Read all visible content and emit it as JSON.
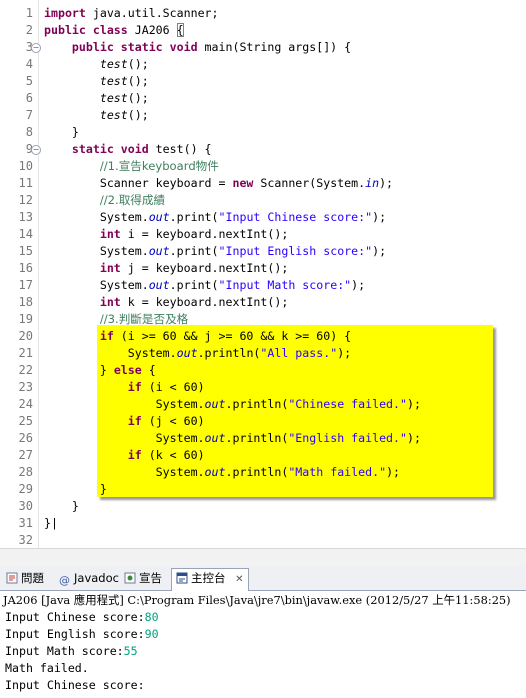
{
  "editor": {
    "lines": [
      {
        "n": "1",
        "html": "<span class=\"kw\">import</span> java.util.Scanner;"
      },
      {
        "n": "2",
        "html": "<span class=\"kw\">public class</span> JA206 <span class=\"bracket\">{</span>"
      },
      {
        "n": "3",
        "fold": "−",
        "html": "    <span class=\"kw\">public static void</span> main(String args[]) {"
      },
      {
        "n": "4",
        "html": "        <span class=\"it\">test</span>();"
      },
      {
        "n": "5",
        "html": "        <span class=\"it\">test</span>();"
      },
      {
        "n": "6",
        "html": "        <span class=\"it\">test</span>();"
      },
      {
        "n": "7",
        "html": "        <span class=\"it\">test</span>();"
      },
      {
        "n": "8",
        "html": "    }"
      },
      {
        "n": "9",
        "fold": "−",
        "html": "    <span class=\"kw\">static void</span> test() {"
      },
      {
        "n": "10",
        "html": "        <span class=\"cm\">//1.宣告keyboard物件</span>"
      },
      {
        "n": "11",
        "html": "        Scanner keyboard = <span class=\"kw\">new</span> Scanner(System.<span class=\"fld\">in</span>);"
      },
      {
        "n": "12",
        "html": "        <span class=\"cm\">//2.取得成績</span>"
      },
      {
        "n": "13",
        "html": "        System.<span class=\"fld\">out</span>.print(<span class=\"str\">\"Input Chinese score:\"</span>);"
      },
      {
        "n": "14",
        "html": "        <span class=\"kw\">int</span> i = keyboard.nextInt();"
      },
      {
        "n": "15",
        "html": "        System.<span class=\"fld\">out</span>.print(<span class=\"str\">\"Input English score:\"</span>);"
      },
      {
        "n": "16",
        "html": "        <span class=\"kw\">int</span> j = keyboard.nextInt();"
      },
      {
        "n": "17",
        "html": "        System.<span class=\"fld\">out</span>.print(<span class=\"str\">\"Input Math score:\"</span>);"
      },
      {
        "n": "18",
        "html": "        <span class=\"kw\">int</span> k = keyboard.nextInt();"
      },
      {
        "n": "19",
        "html": "        <span class=\"cm\">//3.判斷是否及格</span>"
      },
      {
        "n": "20",
        "html": "        <span class=\"kw\">if</span> (i >= 60 && j >= 60 && k >= 60) {"
      },
      {
        "n": "21",
        "html": "            System.<span class=\"fld\">out</span>.println(<span class=\"str\">\"All pass.\"</span>);"
      },
      {
        "n": "22",
        "html": "        } <span class=\"kw\">else</span> {"
      },
      {
        "n": "23",
        "html": "            <span class=\"kw\">if</span> (i < 60)"
      },
      {
        "n": "24",
        "html": "                System.<span class=\"fld\">out</span>.println(<span class=\"str\">\"Chinese failed.\"</span>);"
      },
      {
        "n": "25",
        "html": "            <span class=\"kw\">if</span> (j < 60)"
      },
      {
        "n": "26",
        "html": "                System.<span class=\"fld\">out</span>.println(<span class=\"str\">\"English failed.\"</span>);"
      },
      {
        "n": "27",
        "html": "            <span class=\"kw\">if</span> (k < 60)"
      },
      {
        "n": "28",
        "html": "                System.<span class=\"fld\">out</span>.println(<span class=\"str\">\"Math failed.\"</span>);"
      },
      {
        "n": "29",
        "html": "        }"
      },
      {
        "n": "30",
        "html": "    }"
      },
      {
        "n": "31",
        "html": "}|"
      },
      {
        "n": "32",
        "html": ""
      }
    ]
  },
  "tabs": [
    {
      "icon": "problems-icon",
      "label": "問題",
      "active": false
    },
    {
      "icon": "javadoc-icon",
      "label": "Javadoc",
      "active": false
    },
    {
      "icon": "declaration-icon",
      "label": "宣告",
      "active": false
    },
    {
      "icon": "console-icon",
      "label": "主控台",
      "active": true,
      "close": "✕"
    }
  ],
  "console": {
    "header": "JA206 [Java 應用程式] C:\\Program Files\\Java\\jre7\\bin\\javaw.exe (2012/5/27 上午11:58:25)",
    "lines": [
      {
        "text": "Input Chinese score:",
        "input": "80"
      },
      {
        "text": "Input English score:",
        "input": "90"
      },
      {
        "text": "Input Math score:",
        "input": "55"
      },
      {
        "text": "Math failed.",
        "input": ""
      },
      {
        "text": "Input Chinese score:",
        "input": ""
      }
    ]
  },
  "colors": {
    "highlight": "#ffff00",
    "keyword": "#7f0055",
    "string": "#2a00ff",
    "comment": "#3f7f5f",
    "field": "#0000c0",
    "console_input": "#00a080"
  }
}
